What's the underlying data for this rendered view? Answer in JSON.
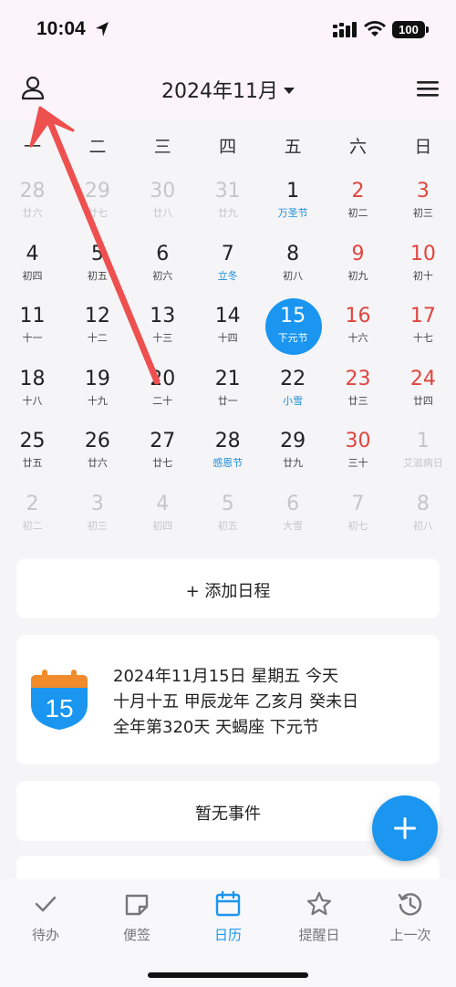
{
  "status_bar": {
    "time": "10:04",
    "battery": "100"
  },
  "header": {
    "title": "2024年11月"
  },
  "weekdays": [
    "一",
    "二",
    "三",
    "四",
    "五",
    "六",
    "日"
  ],
  "calendar": {
    "weeks": [
      [
        {
          "d": "28",
          "s": "廿六",
          "other": true
        },
        {
          "d": "29",
          "s": "廿七",
          "other": true
        },
        {
          "d": "30",
          "s": "廿八",
          "other": true
        },
        {
          "d": "31",
          "s": "廿九",
          "other": true
        },
        {
          "d": "1",
          "s": "万圣节",
          "fest": true
        },
        {
          "d": "2",
          "s": "初二",
          "weekend": true
        },
        {
          "d": "3",
          "s": "初三",
          "weekend": true
        }
      ],
      [
        {
          "d": "4",
          "s": "初四"
        },
        {
          "d": "5",
          "s": "初五"
        },
        {
          "d": "6",
          "s": "初六"
        },
        {
          "d": "7",
          "s": "立冬",
          "fest": true
        },
        {
          "d": "8",
          "s": "初八"
        },
        {
          "d": "9",
          "s": "初九",
          "weekend": true
        },
        {
          "d": "10",
          "s": "初十",
          "weekend": true
        }
      ],
      [
        {
          "d": "11",
          "s": "十一"
        },
        {
          "d": "12",
          "s": "十二"
        },
        {
          "d": "13",
          "s": "十三"
        },
        {
          "d": "14",
          "s": "十四"
        },
        {
          "d": "15",
          "s": "下元节",
          "today": true
        },
        {
          "d": "16",
          "s": "十六",
          "weekend": true
        },
        {
          "d": "17",
          "s": "十七",
          "weekend": true
        }
      ],
      [
        {
          "d": "18",
          "s": "十八"
        },
        {
          "d": "19",
          "s": "十九"
        },
        {
          "d": "20",
          "s": "二十"
        },
        {
          "d": "21",
          "s": "廿一"
        },
        {
          "d": "22",
          "s": "小雪",
          "fest": true
        },
        {
          "d": "23",
          "s": "廿三",
          "weekend": true
        },
        {
          "d": "24",
          "s": "廿四",
          "weekend": true
        }
      ],
      [
        {
          "d": "25",
          "s": "廿五"
        },
        {
          "d": "26",
          "s": "廿六"
        },
        {
          "d": "27",
          "s": "廿七"
        },
        {
          "d": "28",
          "s": "感恩节",
          "fest": true
        },
        {
          "d": "29",
          "s": "廿九"
        },
        {
          "d": "30",
          "s": "三十",
          "weekend": true
        },
        {
          "d": "1",
          "s": "艾滋病日",
          "other": true
        }
      ],
      [
        {
          "d": "2",
          "s": "初二",
          "other": true
        },
        {
          "d": "3",
          "s": "初三",
          "other": true
        },
        {
          "d": "4",
          "s": "初四",
          "other": true
        },
        {
          "d": "5",
          "s": "初五",
          "other": true
        },
        {
          "d": "6",
          "s": "大雪",
          "other": true
        },
        {
          "d": "7",
          "s": "初七",
          "other": true
        },
        {
          "d": "8",
          "s": "初八",
          "other": true
        }
      ]
    ]
  },
  "add_schedule": {
    "label": "+ 添加日程"
  },
  "today_info": {
    "icon_day": "15",
    "line1": "2024年11月15日 星期五 今天",
    "line2": "十月十五 甲辰龙年 乙亥月 癸未日",
    "line3": "全年第320天 天蝎座 下元节"
  },
  "events": {
    "empty_label": "暂无事件"
  },
  "tabs": [
    {
      "label": "待办",
      "icon": "check-icon"
    },
    {
      "label": "便签",
      "icon": "note-icon"
    },
    {
      "label": "日历",
      "icon": "calendar-icon",
      "active": true
    },
    {
      "label": "提醒日",
      "icon": "star-icon"
    },
    {
      "label": "上一次",
      "icon": "history-icon"
    }
  ],
  "colors": {
    "accent": "#1a96f0",
    "weekend": "#e0453f",
    "festival": "#1a8fd8",
    "arrow": "#ee4f4f"
  }
}
